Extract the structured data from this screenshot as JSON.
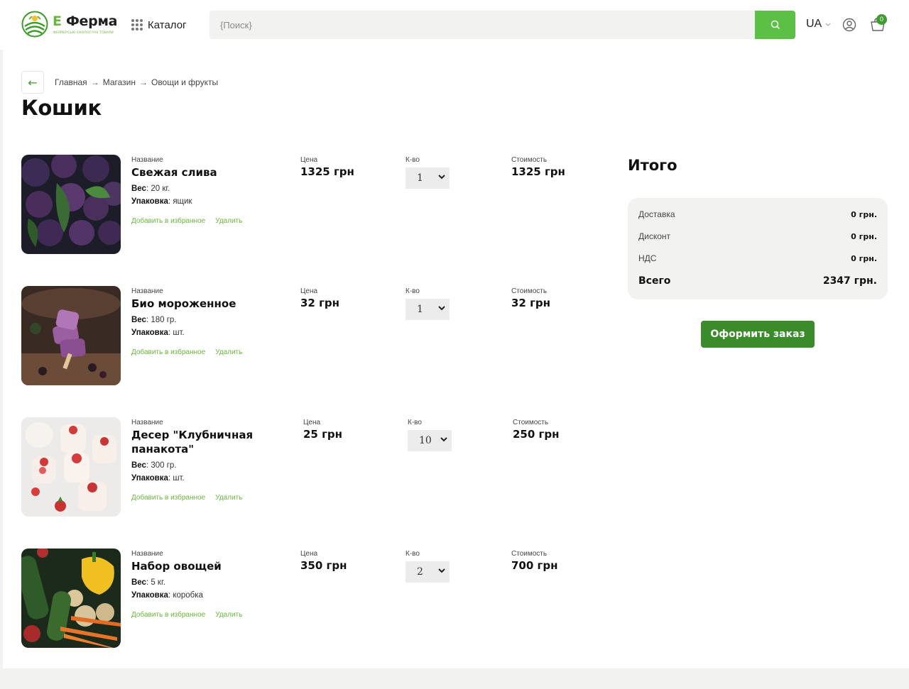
{
  "header": {
    "logo_e": "E",
    "logo_name": "Ферма",
    "logo_tagline": "ФЕРМЕРСЬКІ ЕКОЛОГІЧНІ ТОВАРИ",
    "catalog_label": "Каталог",
    "search_placeholder": "{Поиск}",
    "lang": "UA",
    "cart_count": "0"
  },
  "breadcrumb": {
    "items": [
      "Главная",
      "Магазин",
      "Овощи и фрукты"
    ],
    "separator": "→"
  },
  "page_title": "Кошик",
  "columns": {
    "name": "Название",
    "price": "Цена",
    "qty": "К-во",
    "cost": "Стоимость"
  },
  "labels": {
    "weight": "Вес",
    "pack": "Упаковка",
    "add_fav": "Добавить в избранное",
    "remove": "Удалить"
  },
  "items": [
    {
      "name": "Свежая слива",
      "weight": "20 кг.",
      "pack": "ящик",
      "price": "1325 грн",
      "qty": "1",
      "cost": "1325 грн",
      "image": "plums"
    },
    {
      "name": "Био мороженное",
      "weight": "180 гр.",
      "pack": "шт.",
      "price": "32 грн",
      "qty": "1",
      "cost": "32 грн",
      "image": "ice-cream"
    },
    {
      "name": "Десер \"Клубничная панакота\"",
      "weight": "300 гр.",
      "pack": "шт.",
      "price": "25 грн",
      "qty": "10",
      "cost": "250 грн",
      "image": "panna-cotta"
    },
    {
      "name": "Набор овощей",
      "weight": "5 кг.",
      "pack": "коробка",
      "price": "350 грн",
      "qty": "2",
      "cost": "700 грн",
      "image": "vegetables"
    }
  ],
  "summary": {
    "title": "Итого",
    "delivery_label": "Доставка",
    "delivery_value": "0 грн.",
    "discount_label": "Дисконт",
    "discount_value": "0 грн.",
    "vat_label": "НДС",
    "vat_value": "0 грн.",
    "total_label": "Всего",
    "total_value": "2347 грн.",
    "checkout_label": "Оформить заказ"
  },
  "colors": {
    "accent": "#5cc046",
    "brand_dark": "#3a8b2a",
    "link": "#6bb63e",
    "panel": "#f2f3f1"
  }
}
